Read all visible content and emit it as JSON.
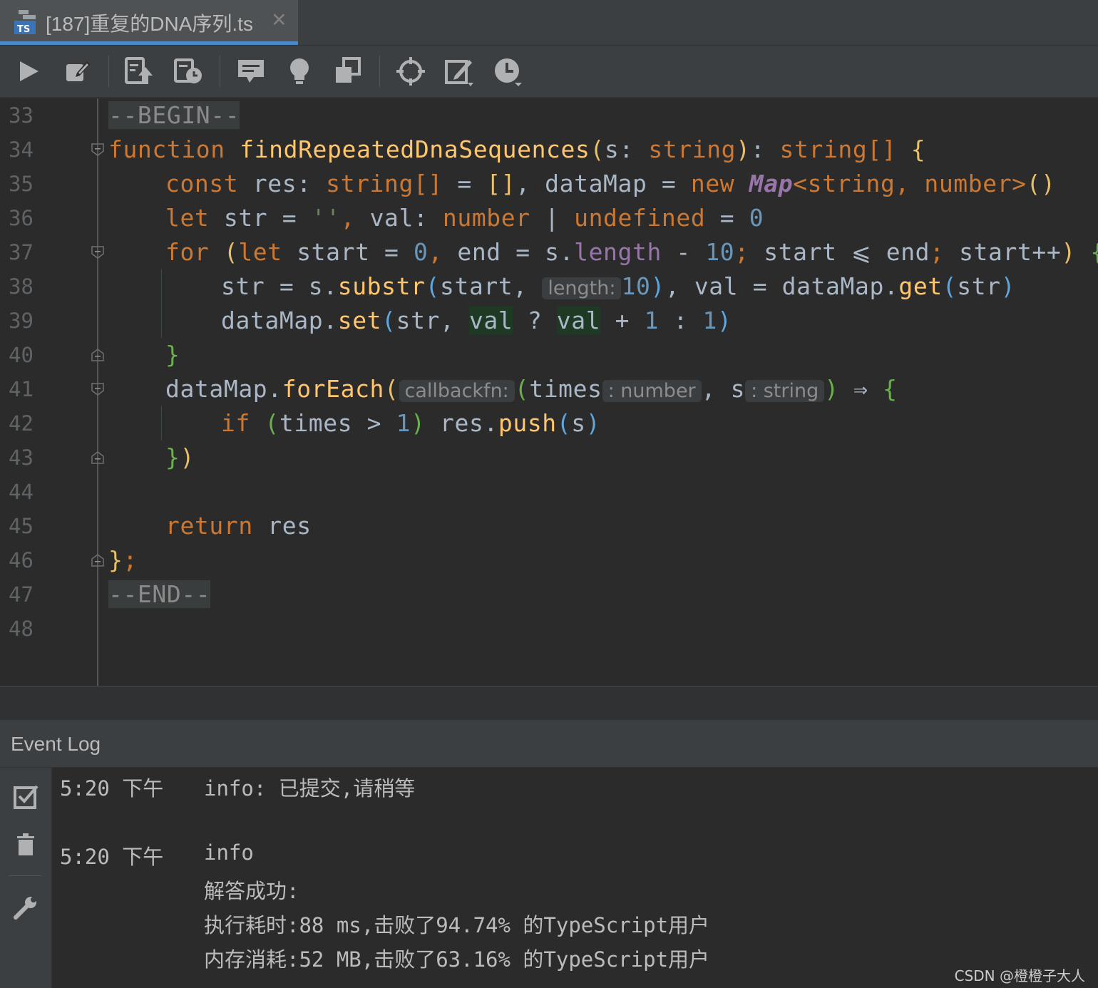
{
  "tab": {
    "title": "[187]重复的DNA序列.ts",
    "close": "✕",
    "icon": "typescript-file-icon",
    "icon_text": "TS"
  },
  "toolbar": {
    "buttons": [
      "run-icon",
      "edit-icon",
      "submit-icon",
      "history-icon",
      "comment-icon",
      "hint-icon",
      "copy-icon",
      "locate-icon",
      "note-icon",
      "timer-icon"
    ]
  },
  "editor": {
    "line_numbers": [
      "33",
      "34",
      "35",
      "36",
      "37",
      "38",
      "39",
      "40",
      "41",
      "42",
      "43",
      "44",
      "45",
      "46",
      "47",
      "48"
    ],
    "markers": {
      "begin": "--BEGIN--",
      "end": "--END--"
    },
    "lines": {
      "l34": {
        "kw": "function",
        "fn": "findRepeatedDnaSequences",
        "p1": "(",
        "a": "s",
        "c1": ": ",
        "t1": "string",
        "p2": ")",
        "c2": ": ",
        "t2": "string[]",
        "sp": " ",
        "b": "{"
      },
      "l35": {
        "kw": "const",
        "a": " res: ",
        "t1": "string[]",
        "b": " = ",
        "arr": "[]",
        "c": ", dataMap = ",
        "nw": "new",
        "sp": " ",
        "cls": "Map",
        "gen": "<string, number>",
        "call": "()"
      },
      "l36": {
        "kw": "let",
        "a": " str = ",
        "s": "''",
        "c": ", ",
        "b": "val: ",
        "t1": "number",
        "pipe": " | ",
        "t2": "undefined",
        "eq": " = ",
        "n": "0"
      },
      "l37": {
        "kw": "for",
        "sp": " ",
        "p1": "(",
        "kw2": "let",
        "a": " start = ",
        "n1": "0",
        "c": ", ",
        "b": "end = s.",
        "prop": "length",
        "m": " - ",
        "n2": "10",
        "sc1": "; ",
        "d": "start ⩽ end",
        "sc2": "; ",
        "e": "start++",
        "p2": ")",
        "sp2": " ",
        "br": "{"
      },
      "l38": {
        "a": "str = s.",
        "fn": "substr",
        "p1": "(",
        "b": "start, ",
        "hint": "length:",
        "n": "10",
        "p2": ")",
        "c": ", val = dataMap.",
        "fn2": "get",
        "p3": "(",
        "d": "str",
        "p4": ")"
      },
      "l39": {
        "a": "dataMap.",
        "fn": "set",
        "p1": "(",
        "b": "str, ",
        "v1": "val",
        "q": " ? ",
        "v2": "val",
        "plus": " + ",
        "n1": "1",
        "col": " : ",
        "n2": "1",
        "p2": ")"
      },
      "l40": {
        "br": "}"
      },
      "l41": {
        "a": "dataMap.",
        "fn": "forEach",
        "p1": "(",
        "hint": "callbackfn:",
        "p2": "(",
        "b": "times",
        "h1": ": number",
        "c": ", s",
        "h2": ": string",
        "p3": ")",
        "arrow": " ⇒ ",
        "br": "{"
      },
      "l42": {
        "kw": "if",
        "sp": " ",
        "p1": "(",
        "a": "times > ",
        "n": "1",
        "p2": ")",
        "b": " res.",
        "fn": "push",
        "p3": "(",
        "c": "s",
        "p4": ")"
      },
      "l43": {
        "br": "}",
        "p": ")"
      },
      "l45": {
        "kw": "return",
        "a": " res"
      },
      "l46": {
        "br": "}",
        "sc": ";"
      }
    }
  },
  "event_log": {
    "title": "Event Log",
    "entries": [
      {
        "time": "5:20 下午",
        "lines": [
          "info: 已提交,请稍等"
        ]
      },
      {
        "time": "5:20 下午",
        "lines": [
          "info",
          "解答成功:",
          "执行耗时:88 ms,击败了94.74% 的TypeScript用户",
          "内存消耗:52 MB,击败了63.16% 的TypeScript用户"
        ]
      }
    ]
  },
  "watermark": "CSDN @橙橙子大人"
}
